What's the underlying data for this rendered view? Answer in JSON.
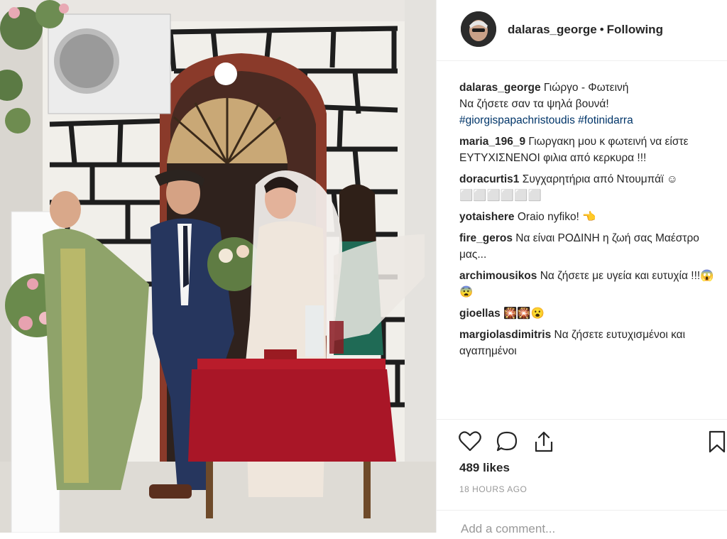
{
  "post": {
    "author": "dalaras_george",
    "follow_status": "Following",
    "separator": "•",
    "caption": {
      "username": "dalaras_george",
      "line1": "Γιώργο - Φωτεινή",
      "line2": "Να ζήσετε σαν τα ψηλά βουνά!",
      "hashtag1": "#giorgispapachristoudis",
      "hashtag2": "#fotinidarra"
    },
    "comments": [
      {
        "username": "maria_196_9",
        "text": "Γιωργακη μου κ φωτεινή να είστε ΕΥΤΥΧΙΣΝΕΝΟΙ φιλια από κερκυρα !!!"
      },
      {
        "username": "doracurtis1",
        "text": "Συγχαρητήρια από Ντουμπάϊ ☺ ⬜⬜⬜⬜⬜⬜"
      },
      {
        "username": "yotaishere",
        "text": "Oraio nyfiko! 👈"
      },
      {
        "username": "fire_geros",
        "text": "Να είναι ΡΟΔΙΝΗ η ζωή σας Μαέστρο μας..."
      },
      {
        "username": "archimousikos",
        "text": "Να ζήσετε με υγεία και ευτυχία !!!😱😨"
      },
      {
        "username": "gioellas",
        "text": "🎇🎇😮"
      },
      {
        "username": "margiolasdimitris",
        "text": "Να ζήσετε ευτυχισμένοι και αγαπημένοι"
      }
    ],
    "likes": "489 likes",
    "timestamp": "18 HOURS AGO",
    "add_comment_placeholder": "Add a comment..."
  },
  "icons": {
    "like": "heart-icon",
    "comment": "comment-bubble-icon",
    "share": "share-icon",
    "save": "bookmark-icon"
  },
  "colors": {
    "text": "#262626",
    "hashtag": "#003569",
    "muted": "#999999",
    "divider": "#efefef"
  }
}
